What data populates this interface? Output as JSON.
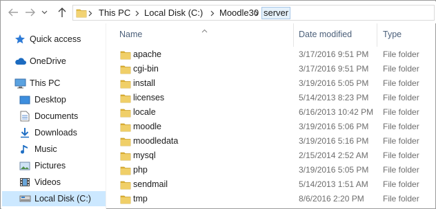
{
  "navigation": {
    "back_icon": "back-arrow-icon",
    "forward_icon": "forward-arrow-icon",
    "history_icon": "chevron-down-icon",
    "up_icon": "up-arrow-icon"
  },
  "address_bar": {
    "folder_icon": "folder-icon",
    "breadcrumbs": [
      "This PC",
      "Local Disk (C:)",
      "Moodle30",
      "server"
    ]
  },
  "sidebar": {
    "items": [
      {
        "label": "Quick access",
        "icon": "star-icon"
      },
      {
        "label": "OneDrive",
        "icon": "cloud-icon"
      },
      {
        "label": "This PC",
        "icon": "computer-icon"
      },
      {
        "label": "Desktop",
        "icon": "desktop-icon"
      },
      {
        "label": "Documents",
        "icon": "documents-icon"
      },
      {
        "label": "Downloads",
        "icon": "download-icon"
      },
      {
        "label": "Music",
        "icon": "music-icon"
      },
      {
        "label": "Pictures",
        "icon": "pictures-icon"
      },
      {
        "label": "Videos",
        "icon": "videos-icon"
      },
      {
        "label": "Local Disk (C:)",
        "icon": "drive-icon",
        "selected": true
      }
    ]
  },
  "columns": {
    "name": "Name",
    "date_modified": "Date modified",
    "type": "Type",
    "sort_icon": "sort-ascending-icon"
  },
  "files": [
    {
      "name": "apache",
      "date": "3/17/2016 9:51 PM",
      "type": "File folder"
    },
    {
      "name": "cgi-bin",
      "date": "3/17/2016 9:51 PM",
      "type": "File folder"
    },
    {
      "name": "install",
      "date": "3/19/2016 5:05 PM",
      "type": "File folder"
    },
    {
      "name": "licenses",
      "date": "5/14/2013 8:23 PM",
      "type": "File folder"
    },
    {
      "name": "locale",
      "date": "6/16/2013 10:42 PM",
      "type": "File folder"
    },
    {
      "name": "moodle",
      "date": "3/19/2016 5:06 PM",
      "type": "File folder"
    },
    {
      "name": "moodledata",
      "date": "3/19/2016 5:16 PM",
      "type": "File folder"
    },
    {
      "name": "mysql",
      "date": "2/15/2014 2:52 AM",
      "type": "File folder"
    },
    {
      "name": "php",
      "date": "3/19/2016 5:05 PM",
      "type": "File folder"
    },
    {
      "name": "sendmail",
      "date": "5/14/2013 1:51 AM",
      "type": "File folder"
    },
    {
      "name": "tmp",
      "date": "8/6/2016 2:20 PM",
      "type": "File folder"
    }
  ],
  "colors": {
    "folder": "#e8c046",
    "selected_bg": "#cce8ff",
    "header_text": "#4c607a"
  }
}
